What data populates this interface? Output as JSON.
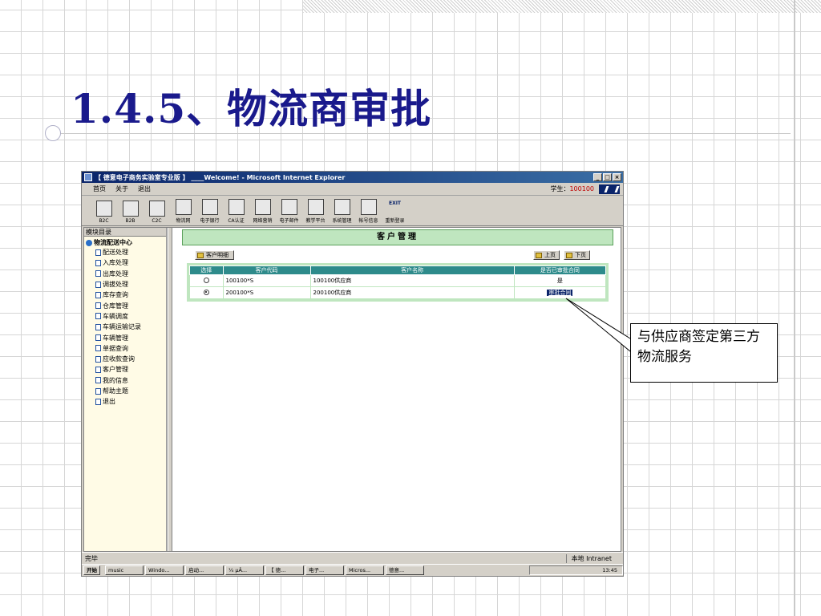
{
  "slide": {
    "title": "1.4.5、物流商审批",
    "callout": "与供应商签定第三方物流服务"
  },
  "window": {
    "title": "【 德意电子商务实验室专业版 】 ____Welcome! - Microsoft Internet Explorer",
    "buttons": [
      "_",
      "□",
      "×"
    ],
    "menu": [
      "首页",
      "关于",
      "退出"
    ],
    "student_label": "学生：",
    "student_id": "100100",
    "toolbar": [
      {
        "label": "B2C",
        "icon": "shopping-cart-icon"
      },
      {
        "label": "B2B",
        "icon": "network-icon"
      },
      {
        "label": "C2C",
        "icon": "store-icon"
      },
      {
        "label": "物流网",
        "icon": "truck-icon"
      },
      {
        "label": "电子银行",
        "icon": "bank-icon"
      },
      {
        "label": "CA认证",
        "icon": "certificate-icon"
      },
      {
        "label": "网络营销",
        "icon": "marketing-icon"
      },
      {
        "label": "电子邮件",
        "icon": "mail-icon"
      },
      {
        "label": "教学平台",
        "icon": "teaching-icon"
      },
      {
        "label": "系统管理",
        "icon": "system-icon"
      },
      {
        "label": "帐号信息",
        "icon": "account-icon"
      },
      {
        "label": "重新登录",
        "icon": "exit-icon",
        "icon_text": "EXIT"
      }
    ]
  },
  "sidebar": {
    "header": "模块目录",
    "root": "物流配送中心",
    "items": [
      "配送处理",
      "入库处理",
      "出库处理",
      "调拔处理",
      "库存查询",
      "仓库管理",
      "车辆调度",
      "车辆运输记录",
      "车辆管理",
      "单据查询",
      "应收款查询",
      "客户管理",
      "我的信息",
      "帮助主题",
      "退出"
    ]
  },
  "main": {
    "header": "客户管理",
    "detail_button": "客户明细",
    "prev_button": "上页",
    "next_button": "下页",
    "columns": [
      "选择",
      "客户代码",
      "客户名称",
      "是否已审批合同"
    ],
    "rows": [
      {
        "selected": false,
        "code": "100100*S",
        "name": "100100供应商",
        "approved": "是"
      },
      {
        "selected": true,
        "code": "200100*S",
        "name": "200100供应商",
        "approved": "审批合同"
      }
    ]
  },
  "statusbar": {
    "status": "完毕",
    "zone": "本地 Intranet"
  },
  "taskbar": {
    "start": "开始",
    "tasks": [
      "music",
      "Windo...",
      "启动...",
      "¼ µÂ...",
      "【 德...",
      "电子...",
      "Micros...",
      "德意..."
    ],
    "clock": "13:45"
  },
  "colors": {
    "title": "#1a1a8c",
    "header_bg": "#bfe6bf",
    "table_head": "#2e8b8b",
    "ie_title": "#0a246a"
  }
}
